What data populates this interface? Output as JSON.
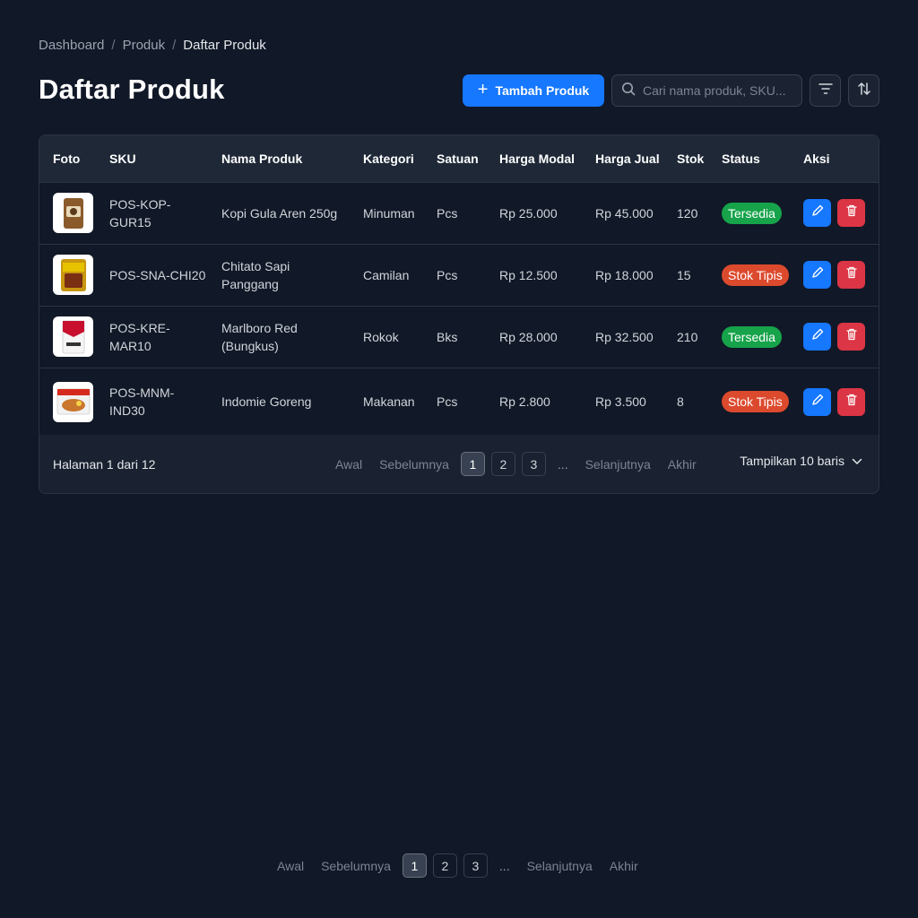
{
  "breadcrumb": [
    "Dashboard",
    "Produk",
    "Daftar Produk"
  ],
  "page_title": "Daftar Produk",
  "toolbar": {
    "add_label": "Tambah Produk",
    "search_placeholder": "Cari nama produk, SKU..."
  },
  "table": {
    "headers": [
      "Foto",
      "SKU",
      "Nama Produk",
      "Kategori",
      "Satuan",
      "Harga Modal",
      "Harga Jual",
      "Stok",
      "Status",
      "Aksi"
    ],
    "rows": [
      {
        "sku": "POS-KOP-GUR15",
        "name": "Kopi Gula Aren 250g",
        "category": "Minuman",
        "unit": "Pcs",
        "cost": "Rp 25.000",
        "price": "Rp 45.000",
        "stock": "120",
        "status": "Tersedia"
      },
      {
        "sku": "POS-SNA-CHI20",
        "name": "Chitato Sapi Panggang",
        "category": "Camilan",
        "unit": "Pcs",
        "cost": "Rp 12.500",
        "price": "Rp 18.000",
        "stock": "15",
        "status": "Stok Tipis"
      },
      {
        "sku": "POS-KRE-MAR10",
        "name": "Marlboro Red (Bungkus)",
        "category": "Rokok",
        "unit": "Bks",
        "cost": "Rp 28.000",
        "price": "Rp 32.500",
        "stock": "210",
        "status": "Tersedia"
      },
      {
        "sku": "POS-MNM-IND30",
        "name": "Indomie Goreng",
        "category": "Makanan",
        "unit": "Pcs",
        "cost": "Rp 2.800",
        "price": "Rp 3.500",
        "stock": "8",
        "status": "Stok Tipis"
      }
    ]
  },
  "pagination": {
    "page_info": "Halaman 1 dari 12",
    "first": "Awal",
    "prev": "Sebelumnya",
    "pages": [
      "1",
      "2",
      "3"
    ],
    "ellipsis": "...",
    "next": "Selanjutnya",
    "last": "Akhir",
    "rows_label": "Tampilkan 10 baris"
  },
  "colors": {
    "accent": "#1677ff",
    "available": "#16a34a",
    "low_stock": "#dc4a2e",
    "danger": "#dc3545"
  }
}
